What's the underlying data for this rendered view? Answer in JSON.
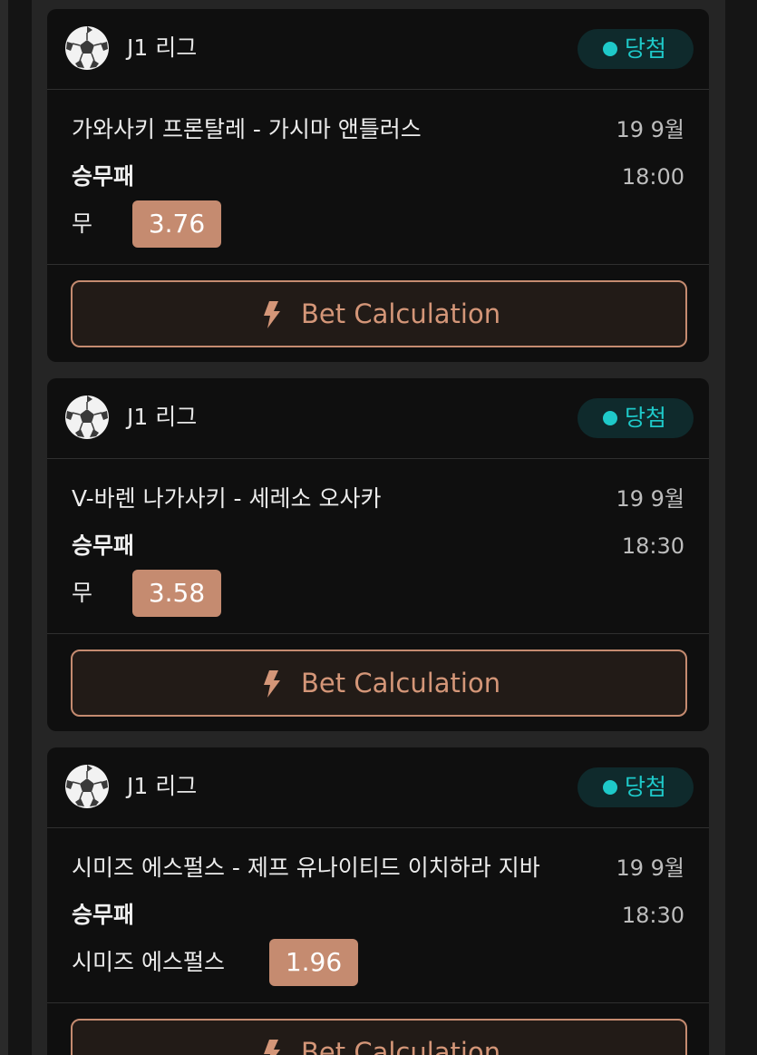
{
  "colors": {
    "background": "#252525",
    "card": "#0f0f0f",
    "accent_odds": "#c58b70",
    "status_teal": "#1ec9c9",
    "button_text": "#d49678"
  },
  "cards": [
    {
      "league_icon": "soccer-ball-icon",
      "league": "J1 리그",
      "status": "당첨",
      "match": "가와사키 프론탈레 - 가시마 앤틀러스",
      "date": "19 9월",
      "market": "승무패",
      "time": "18:00",
      "pick": "무",
      "odds": "3.76",
      "bet_icon": "lightning-bolt-icon",
      "bet_label": "Bet Calculation"
    },
    {
      "league_icon": "soccer-ball-icon",
      "league": "J1 리그",
      "status": "당첨",
      "match": "V-바렌 나가사키 - 세레소 오사카",
      "date": "19 9월",
      "market": "승무패",
      "time": "18:30",
      "pick": "무",
      "odds": "3.58",
      "bet_icon": "lightning-bolt-icon",
      "bet_label": "Bet Calculation"
    },
    {
      "league_icon": "soccer-ball-icon",
      "league": "J1 리그",
      "status": "당첨",
      "match": "시미즈 에스펄스 - 제프 유나이티드 이치하라 지바",
      "date": "19 9월",
      "market": "승무패",
      "time": "18:30",
      "pick": "시미즈 에스펄스",
      "odds": "1.96",
      "bet_icon": "lightning-bolt-icon",
      "bet_label": "Bet Calculation"
    }
  ]
}
